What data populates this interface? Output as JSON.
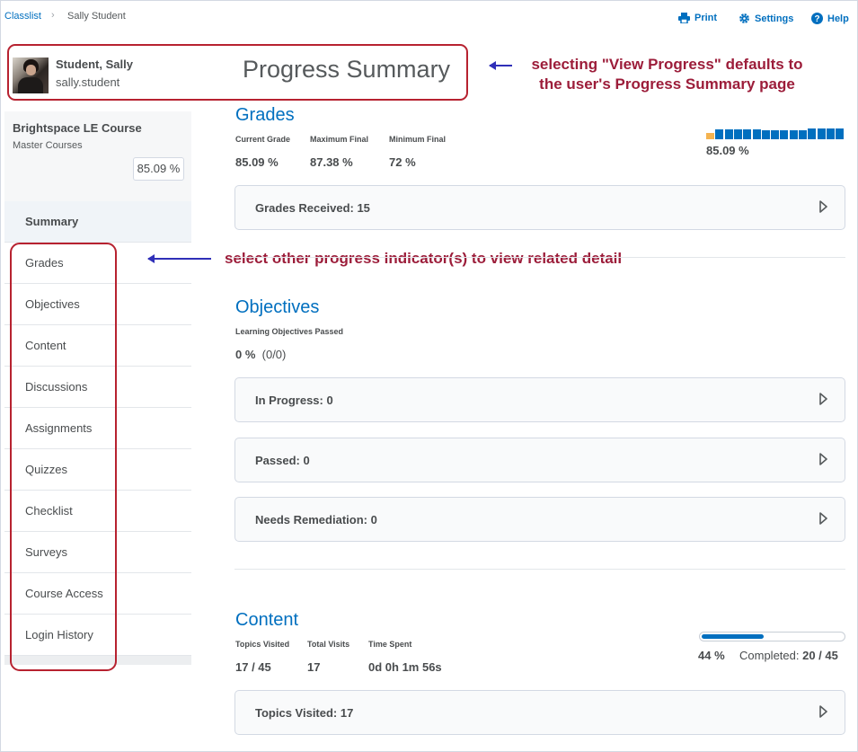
{
  "breadcrumb": {
    "link": "Classlist",
    "separator": "›",
    "current": "Sally Student"
  },
  "toolbar": {
    "print": "Print",
    "settings": "Settings",
    "help": "Help"
  },
  "profile": {
    "name": "Student, Sally",
    "username": "sally.student"
  },
  "page_title": "Progress Summary",
  "annotations": {
    "header_note": "selecting \"View Progress\" defaults to the user's Progress Summary page",
    "nav_note": "select other progress indicator(s) to view related detail"
  },
  "course": {
    "name": "Brightspace LE Course",
    "subtitle": "Master Courses",
    "grade": "85.09 %"
  },
  "nav": {
    "items": [
      {
        "label": "Summary"
      },
      {
        "label": "Grades"
      },
      {
        "label": "Objectives"
      },
      {
        "label": "Content"
      },
      {
        "label": "Discussions"
      },
      {
        "label": "Assignments"
      },
      {
        "label": "Quizzes"
      },
      {
        "label": "Checklist"
      },
      {
        "label": "Surveys"
      },
      {
        "label": "Course Access"
      },
      {
        "label": "Login History"
      }
    ]
  },
  "grades": {
    "title": "Grades",
    "stats": [
      {
        "label": "Current Grade",
        "value": "85.09 %"
      },
      {
        "label": "Maximum Final",
        "value": "87.38 %"
      },
      {
        "label": "Minimum Final",
        "value": "72 %"
      }
    ],
    "sparkline_value": "85.09 %",
    "sparkline_levels": [
      0.45,
      0.75,
      0.7,
      0.7,
      0.7,
      0.7,
      0.65,
      0.65,
      0.65,
      0.65,
      0.65,
      0.8,
      0.8,
      0.8,
      0.8
    ],
    "sparkline_colors": [
      "#f4b350",
      "#006fbf"
    ],
    "card": "Grades Received: 15"
  },
  "objectives": {
    "title": "Objectives",
    "stat_label": "Learning Objectives Passed",
    "stat_value": "0 %",
    "stat_detail": "(0/0)",
    "cards": [
      "In Progress: 0",
      "Passed: 0",
      "Needs Remediation: 0"
    ]
  },
  "content": {
    "title": "Content",
    "stats": [
      {
        "label": "Topics Visited",
        "value": "17 / 45"
      },
      {
        "label": "Total Visits",
        "value": "17"
      },
      {
        "label": "Time Spent",
        "value": "0d 0h 1m 56s"
      }
    ],
    "progress_fraction": 0.44,
    "progress_pct": "44 %",
    "completed_label": "Completed:",
    "completed_value": "20 / 45",
    "card": "Topics Visited: 17"
  },
  "colors": {
    "link": "#006fbf",
    "annotation": "#9c1d3a",
    "highlight_border": "#b72230",
    "arrow": "#2f2fb8"
  }
}
